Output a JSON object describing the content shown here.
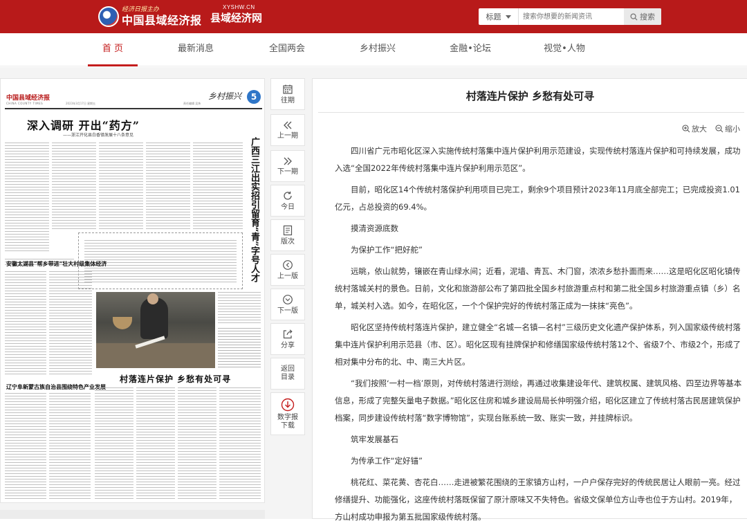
{
  "header": {
    "logo_small": "经济日报主办",
    "logo_main": "中国县域经济报",
    "logo2_url": "XYSHW.CN",
    "logo2_main": "县域经济网",
    "search": {
      "select_label": "标题",
      "placeholder": "搜索你想要的新闻资讯",
      "button_label": "搜索"
    }
  },
  "nav": {
    "items": [
      "首 页",
      "最新消息",
      "全国两会",
      "乡村振兴",
      "金融•论坛",
      "视觉•人物"
    ],
    "active_index": 0
  },
  "paper": {
    "name": "中国县域经济报",
    "name_en": "CHINA COUNTY TIMES",
    "date": "2023年3月17日  星期五",
    "editor": "责任编辑 吴炜",
    "section": "乡村振兴",
    "page_number": "5",
    "headline": "深入调研 开出“药方”",
    "headline_sub": "——浙江开化县白香镇发展十八条意见",
    "vertical_headline": "广西三江出实招引留育“青”字号人才",
    "story2_title": "安徽太湖县“帮乡带进”壮大村级集体经济",
    "story3_title": "辽宁阜新蒙古族自治县围绕特色产业发展",
    "photo_title": "村落连片保护  乡愁有处可寻"
  },
  "toolbar": {
    "items": [
      {
        "label": "往期",
        "icon": "calendar-icon"
      },
      {
        "label": "上一期",
        "icon": "double-chevron-left-icon"
      },
      {
        "label": "下一期",
        "icon": "double-chevron-right-icon"
      },
      {
        "label": "今日",
        "icon": "refresh-icon"
      },
      {
        "label": "版次",
        "icon": "document-icon"
      },
      {
        "label": "上一版",
        "icon": "chevron-circle-left-icon"
      },
      {
        "label": "下一版",
        "icon": "chevron-circle-down-icon"
      },
      {
        "label": "分享",
        "icon": "share-icon"
      },
      {
        "label": "返回\n目录",
        "icon": ""
      },
      {
        "label": "数字报\n下载",
        "icon": "download-icon"
      }
    ]
  },
  "article": {
    "title": "村落连片保护 乡愁有处可寻",
    "zoom_in": "放大",
    "zoom_out": "缩小",
    "paragraphs": [
      "四川省广元市昭化区深入实施传统村落集中连片保护利用示范建设，实现传统村落连片保护和可持续发展，成功入选“全国2022年传统村落集中连片保护利用示范区”。",
      "目前，昭化区14个传统村落保护利用项目已完工，剩余9个项目预计2023年11月底全部完工；已完成投资1.01亿元，占总投资的69.4%。",
      "摸清资源底数",
      "为保护工作“把好舵”",
      "远眺，依山就势，镶嵌在青山绿水间；近看，泥墙、青瓦、木门窗，浓浓乡愁扑面而来……这是昭化区昭化镇传统村落城关村的景色。日前，文化和旅游部公布了第四批全国乡村旅游重点村和第二批全国乡村旅游重点镇（乡）名单，城关村入选。如今，在昭化区，一个个保护完好的传统村落正成为一抹抹“亮色”。",
      "昭化区坚持传统村落连片保护，建立健全“名城—名镇—名村”三级历史文化遗产保护体系，列入国家级传统村落集中连片保护利用示范县（市、区）。昭化区现有挂牌保护和修缮国家级传统村落12个、省级7个、市级2个，形成了相对集中分布的北、中、南三大片区。",
      "“我们按照‘一村一档’原则，对传统村落进行测绘，再通过收集建设年代、建筑权属、建筑风格、四至边界等基本信息，形成了完整矢量电子数据。”昭化区住房和城乡建设局局长仲明强介绍，昭化区建立了传统村落古民居建筑保护档案，同步建设传统村落“数字博物馆”，实现台账系统一致、账实一致，并挂牌标识。",
      "筑牢发展基石",
      "为传承工作“定好锚”",
      "桃花红、菜花黄、杏花白……走进被繁花围绕的王家镇方山村，一户户保存完好的传统民居让人眼前一亮。经过修缮提升、功能强化，这座传统村落既保留了原汁原味又不失特色。省级文保单位方山寺也位于方山村。2019年，方山村成功申报为第五批国家级传统村落。"
    ]
  },
  "colors": {
    "brand_red": "#b81a1a",
    "active_nav": "#c41d1d",
    "page_badge": "#2f76c8"
  }
}
